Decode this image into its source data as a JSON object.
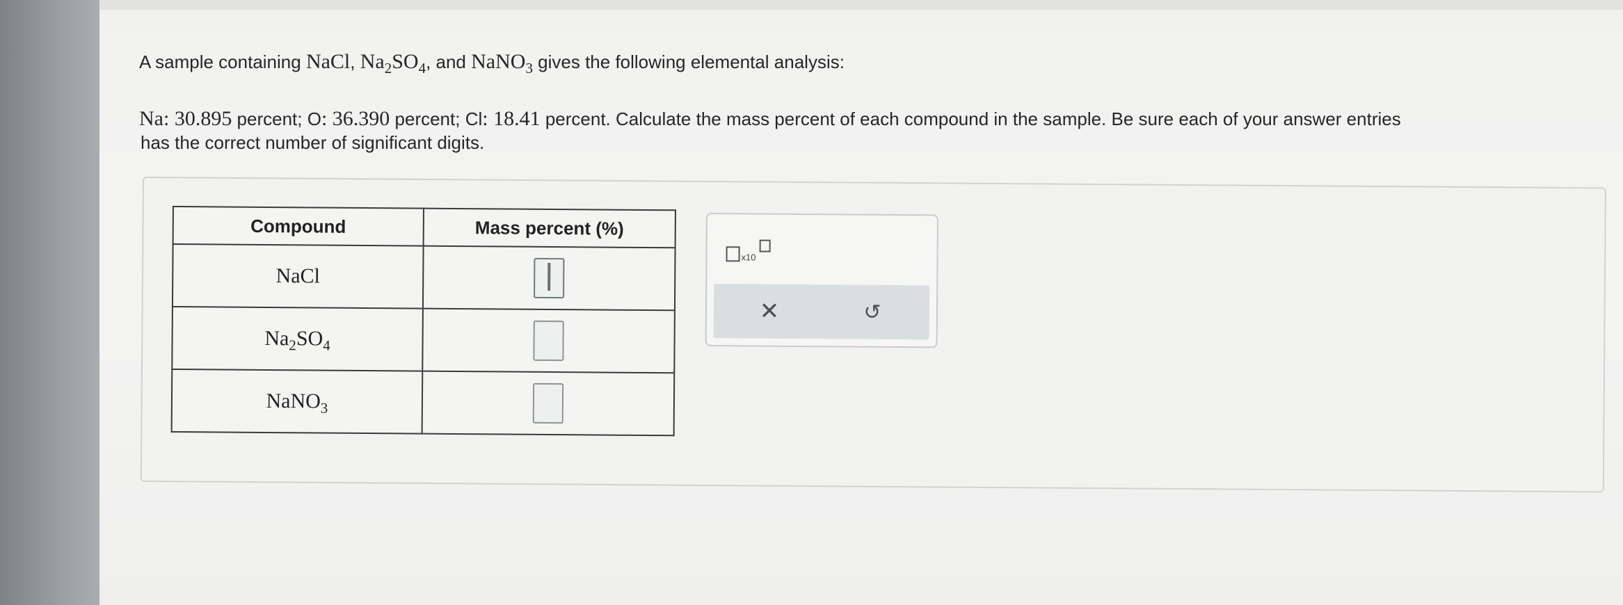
{
  "question": {
    "intro_start": "A sample containing ",
    "intro_sep1": ", ",
    "intro_and": ", and ",
    "intro_end": " gives the following elemental analysis:",
    "na_label": "Na",
    "na_value": ": 30.895",
    "o_label": " percent; O",
    "o_value": ": 36.390",
    "cl_label": " percent; Cl",
    "cl_value": ": 18.41",
    "instruction": " percent. Calculate the mass percent of each compound in the sample. Be sure each of your answer entries",
    "instruction_cont": "has the correct number of significant digits."
  },
  "formulas": {
    "nacl": "NaCl",
    "na2so4_a": "Na",
    "na2so4_sub1": "2",
    "na2so4_b": "SO",
    "na2so4_sub2": "4",
    "nano3_a": "NaNO",
    "nano3_sub": "3"
  },
  "table": {
    "header_compound": "Compound",
    "header_mass": "Mass percent (%)",
    "rows": [
      {
        "compound": "NaCl",
        "mass_percent": ""
      },
      {
        "compound": "Na2SO4",
        "mass_percent": ""
      },
      {
        "compound": "NaNO3",
        "mass_percent": ""
      }
    ]
  },
  "toolbox": {
    "sci_notation_label": "x10",
    "clear_icon": "✕",
    "undo_icon": "↺"
  }
}
